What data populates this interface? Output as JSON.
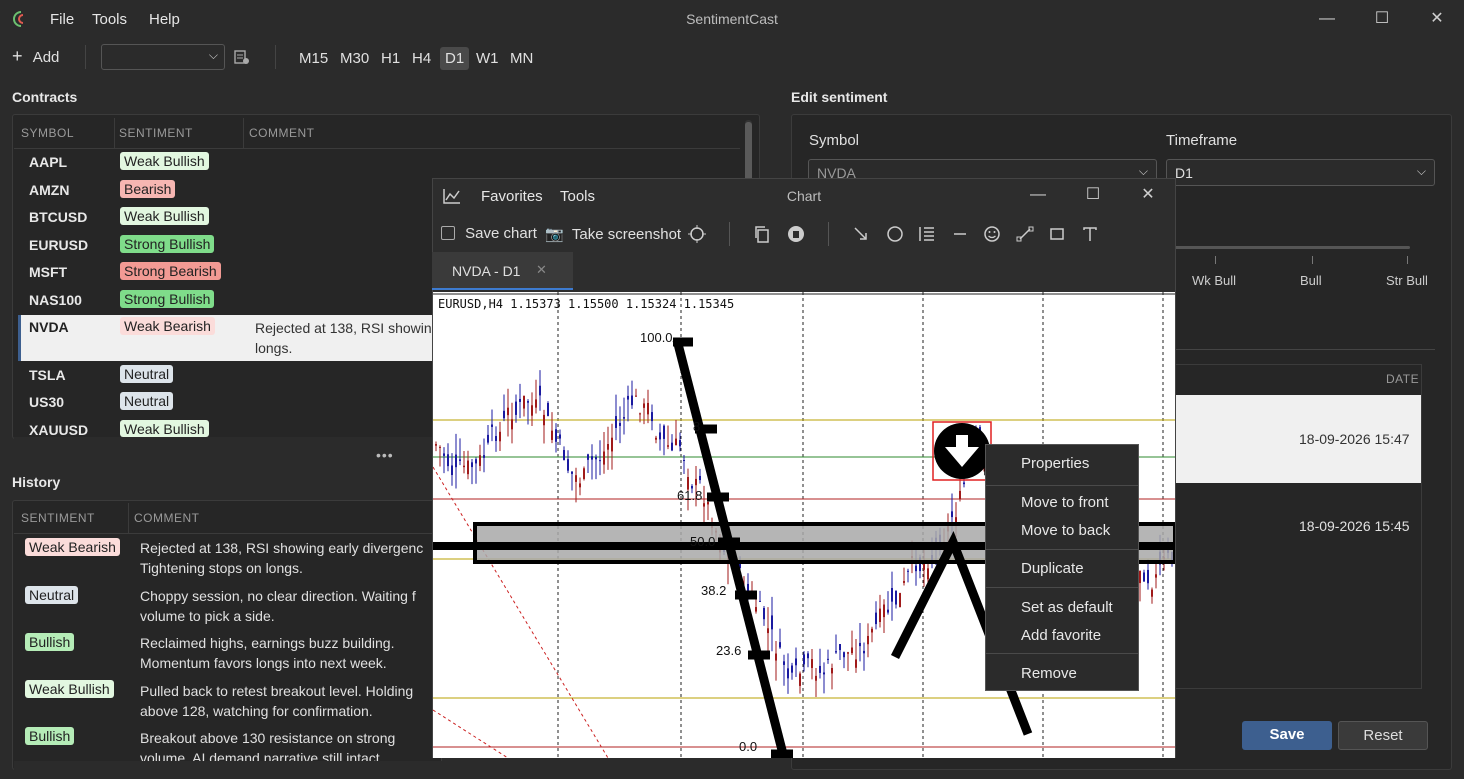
{
  "app": {
    "title": "SentimentCast"
  },
  "menu": {
    "file": "File",
    "tools": "Tools",
    "help": "Help"
  },
  "toolbar": {
    "add": "Add",
    "timeframes": [
      "M15",
      "M30",
      "H1",
      "H4",
      "D1",
      "W1",
      "MN"
    ],
    "active": "D1"
  },
  "contracts": {
    "title": "Contracts",
    "headers": {
      "symbol": "SYMBOL",
      "sentiment": "SENTIMENT",
      "comment": "COMMENT"
    },
    "rows": [
      {
        "symbol": "AAPL",
        "sentiment": "Weak Bullish",
        "comment": ""
      },
      {
        "symbol": "AMZN",
        "sentiment": "Bearish",
        "comment": ""
      },
      {
        "symbol": "BTCUSD",
        "sentiment": "Weak Bullish",
        "comment": ""
      },
      {
        "symbol": "EURUSD",
        "sentiment": "Strong Bullish",
        "comment": ""
      },
      {
        "symbol": "MSFT",
        "sentiment": "Strong Bearish",
        "comment": ""
      },
      {
        "symbol": "NAS100",
        "sentiment": "Strong Bullish",
        "comment": ""
      },
      {
        "symbol": "NVDA",
        "sentiment": "Weak Bearish",
        "comment": "Rejected at 138, RSI showin",
        "comment2": "longs."
      },
      {
        "symbol": "TSLA",
        "sentiment": "Neutral",
        "comment": ""
      },
      {
        "symbol": "US30",
        "sentiment": "Neutral",
        "comment": ""
      },
      {
        "symbol": "XAUUSD",
        "sentiment": "Weak Bullish",
        "comment": ""
      }
    ],
    "splitter": "•••"
  },
  "history": {
    "title": "History",
    "headers": {
      "sentiment": "SENTIMENT",
      "comment": "COMMENT"
    },
    "rows": [
      {
        "sentiment": "Weak Bearish",
        "line1": "Rejected at 138, RSI showing early divergenc",
        "line2": "Tightening stops on longs."
      },
      {
        "sentiment": "Neutral",
        "line1": "Choppy session, no clear direction. Waiting f",
        "line2": "volume to pick a side."
      },
      {
        "sentiment": "Bullish",
        "line1": "Reclaimed highs, earnings buzz building.",
        "line2": "Momentum favors longs into next week."
      },
      {
        "sentiment": "Weak Bullish",
        "line1": "Pulled back to retest breakout level. Holding",
        "line2": "above 128, watching for confirmation."
      },
      {
        "sentiment": "Bullish",
        "line1": "Breakout above 130 resistance on strong",
        "line2": "volume. AI demand narrative still intact."
      }
    ]
  },
  "edit": {
    "title": "Edit sentiment",
    "symbol_label": "Symbol",
    "symbol_value": "NVDA",
    "timeframe_label": "Timeframe",
    "timeframe_value": "D1",
    "scale": [
      "Wk Bull",
      "Bull",
      "Str Bull"
    ],
    "date_header": "DATE",
    "dates": [
      "18-09-2026 15:47",
      "18-09-2026 15:45"
    ],
    "save": "Save",
    "reset": "Reset"
  },
  "chart": {
    "title": "Chart",
    "menu": {
      "favorites": "Favorites",
      "tools": "Tools"
    },
    "save_chart": "Save chart",
    "screenshot": "Take screenshot",
    "tab": "NVDA - D1",
    "info": "EURUSD,H4  1.15373 1.15500 1.15324 1.15345",
    "fib_labels": [
      "100.0",
      "61.8",
      "50.0",
      "38.2",
      "23.6",
      "0.0"
    ],
    "fib_small": "8"
  },
  "context_menu": {
    "items": [
      "Properties",
      "Move to front",
      "Move to back",
      "Duplicate",
      "Set as default",
      "Add favorite",
      "Remove"
    ]
  },
  "colors": {
    "accent": "#3d5f8f",
    "bull": "#7fdc8a",
    "bear": "#f29a94"
  }
}
